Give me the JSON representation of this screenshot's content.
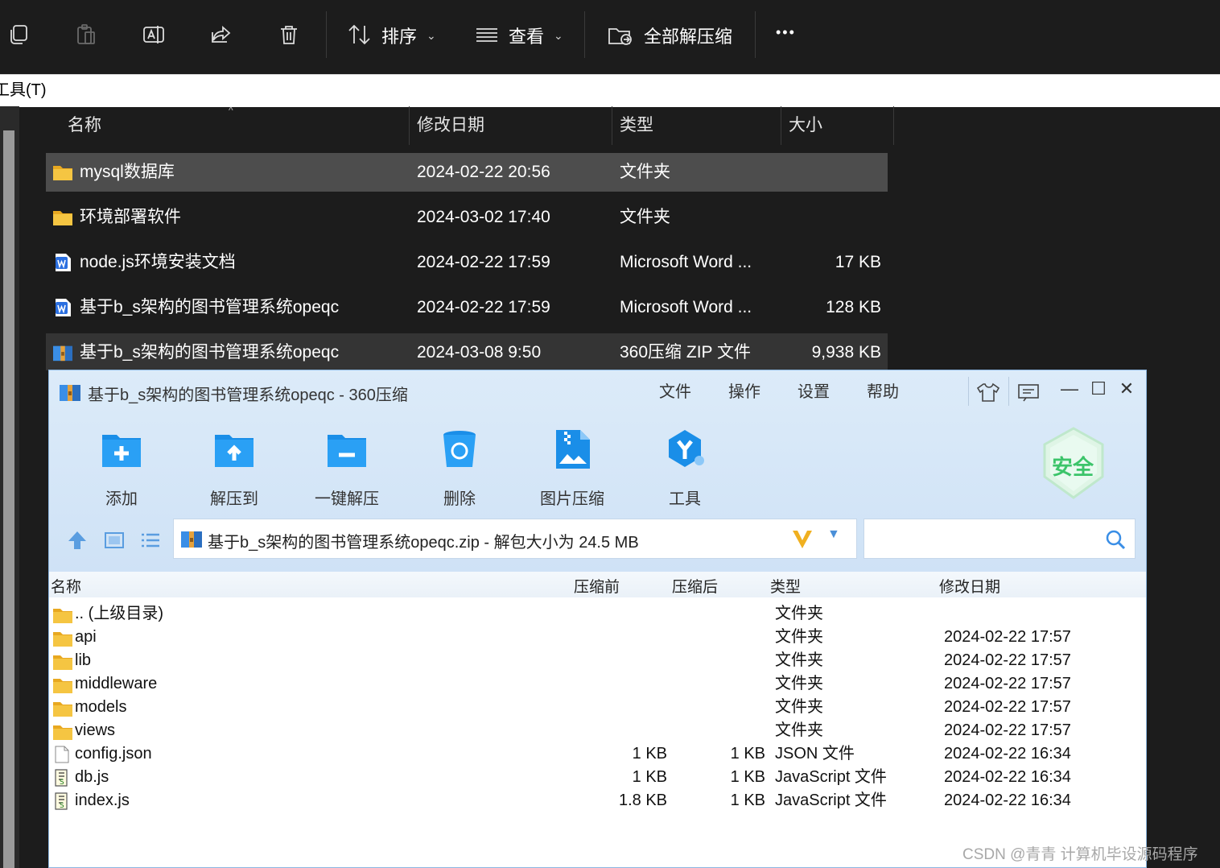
{
  "toolbar": {
    "sort_label": "排序",
    "view_label": "查看",
    "extract_all_label": "全部解压缩",
    "more_label": "•••"
  },
  "menubar": {
    "tools": "工具(T)"
  },
  "explorer": {
    "columns": {
      "name": "名称",
      "modified": "修改日期",
      "type": "类型",
      "size": "大小"
    },
    "rows": [
      {
        "name": "mysql数据库",
        "modified": "2024-02-22 20:56",
        "type": "文件夹",
        "size": "",
        "icon": "folder-icon"
      },
      {
        "name": "环境部署软件",
        "modified": "2024-03-02 17:40",
        "type": "文件夹",
        "size": "",
        "icon": "folder-icon"
      },
      {
        "name": "node.js环境安装文档",
        "modified": "2024-02-22 17:59",
        "type": "Microsoft Word ...",
        "size": "17 KB",
        "icon": "word-icon"
      },
      {
        "name": "基于b_s架构的图书管理系统opeqc",
        "modified": "2024-02-22 17:59",
        "type": "Microsoft Word ...",
        "size": "128 KB",
        "icon": "word-icon"
      },
      {
        "name": "基于b_s架构的图书管理系统opeqc",
        "modified": "2024-03-08 9:50",
        "type": "360压缩 ZIP 文件",
        "size": "9,938 KB",
        "icon": "zip-icon"
      }
    ]
  },
  "zip_window": {
    "title": "基于b_s架构的图书管理系统opeqc - 360压缩",
    "menu": [
      "文件",
      "操作",
      "设置",
      "帮助"
    ],
    "buttons": {
      "add": "添加",
      "extract_to": "解压到",
      "one_click": "一键解压",
      "delete": "删除",
      "image_compress": "图片压缩",
      "tools": "工具"
    },
    "shield_label": "安全",
    "address": "基于b_s架构的图书管理系统opeqc.zip - 解包大小为 24.5 MB",
    "columns": {
      "name": "名称",
      "before": "压缩前",
      "after": "压缩后",
      "type": "类型",
      "modified": "修改日期"
    },
    "rows": [
      {
        "name": ".. (上级目录)",
        "before": "",
        "after": "",
        "type": "文件夹",
        "modified": "",
        "icon": "folder-icon"
      },
      {
        "name": "api",
        "before": "",
        "after": "",
        "type": "文件夹",
        "modified": "2024-02-22 17:57",
        "icon": "folder-icon"
      },
      {
        "name": "lib",
        "before": "",
        "after": "",
        "type": "文件夹",
        "modified": "2024-02-22 17:57",
        "icon": "folder-icon"
      },
      {
        "name": "middleware",
        "before": "",
        "after": "",
        "type": "文件夹",
        "modified": "2024-02-22 17:57",
        "icon": "folder-icon"
      },
      {
        "name": "models",
        "before": "",
        "after": "",
        "type": "文件夹",
        "modified": "2024-02-22 17:57",
        "icon": "folder-icon"
      },
      {
        "name": "views",
        "before": "",
        "after": "",
        "type": "文件夹",
        "modified": "2024-02-22 17:57",
        "icon": "folder-icon"
      },
      {
        "name": "config.json",
        "before": "1 KB",
        "after": "1 KB",
        "type": "JSON 文件",
        "modified": "2024-02-22 16:34",
        "icon": "file-icon"
      },
      {
        "name": "db.js",
        "before": "1 KB",
        "after": "1 KB",
        "type": "JavaScript 文件",
        "modified": "2024-02-22 16:34",
        "icon": "script-icon"
      },
      {
        "name": "index.js",
        "before": "1.8 KB",
        "after": "1 KB",
        "type": "JavaScript 文件",
        "modified": "2024-02-22 16:34",
        "icon": "script-icon"
      }
    ]
  },
  "watermark": "CSDN @青青  计算机毕设源码程序",
  "colors": {
    "explorer_bg": "#1c1c1c",
    "selected_row": "#4d4d4d",
    "accent_blue": "#1a8ee8",
    "folder_yellow": "#f5c542"
  }
}
